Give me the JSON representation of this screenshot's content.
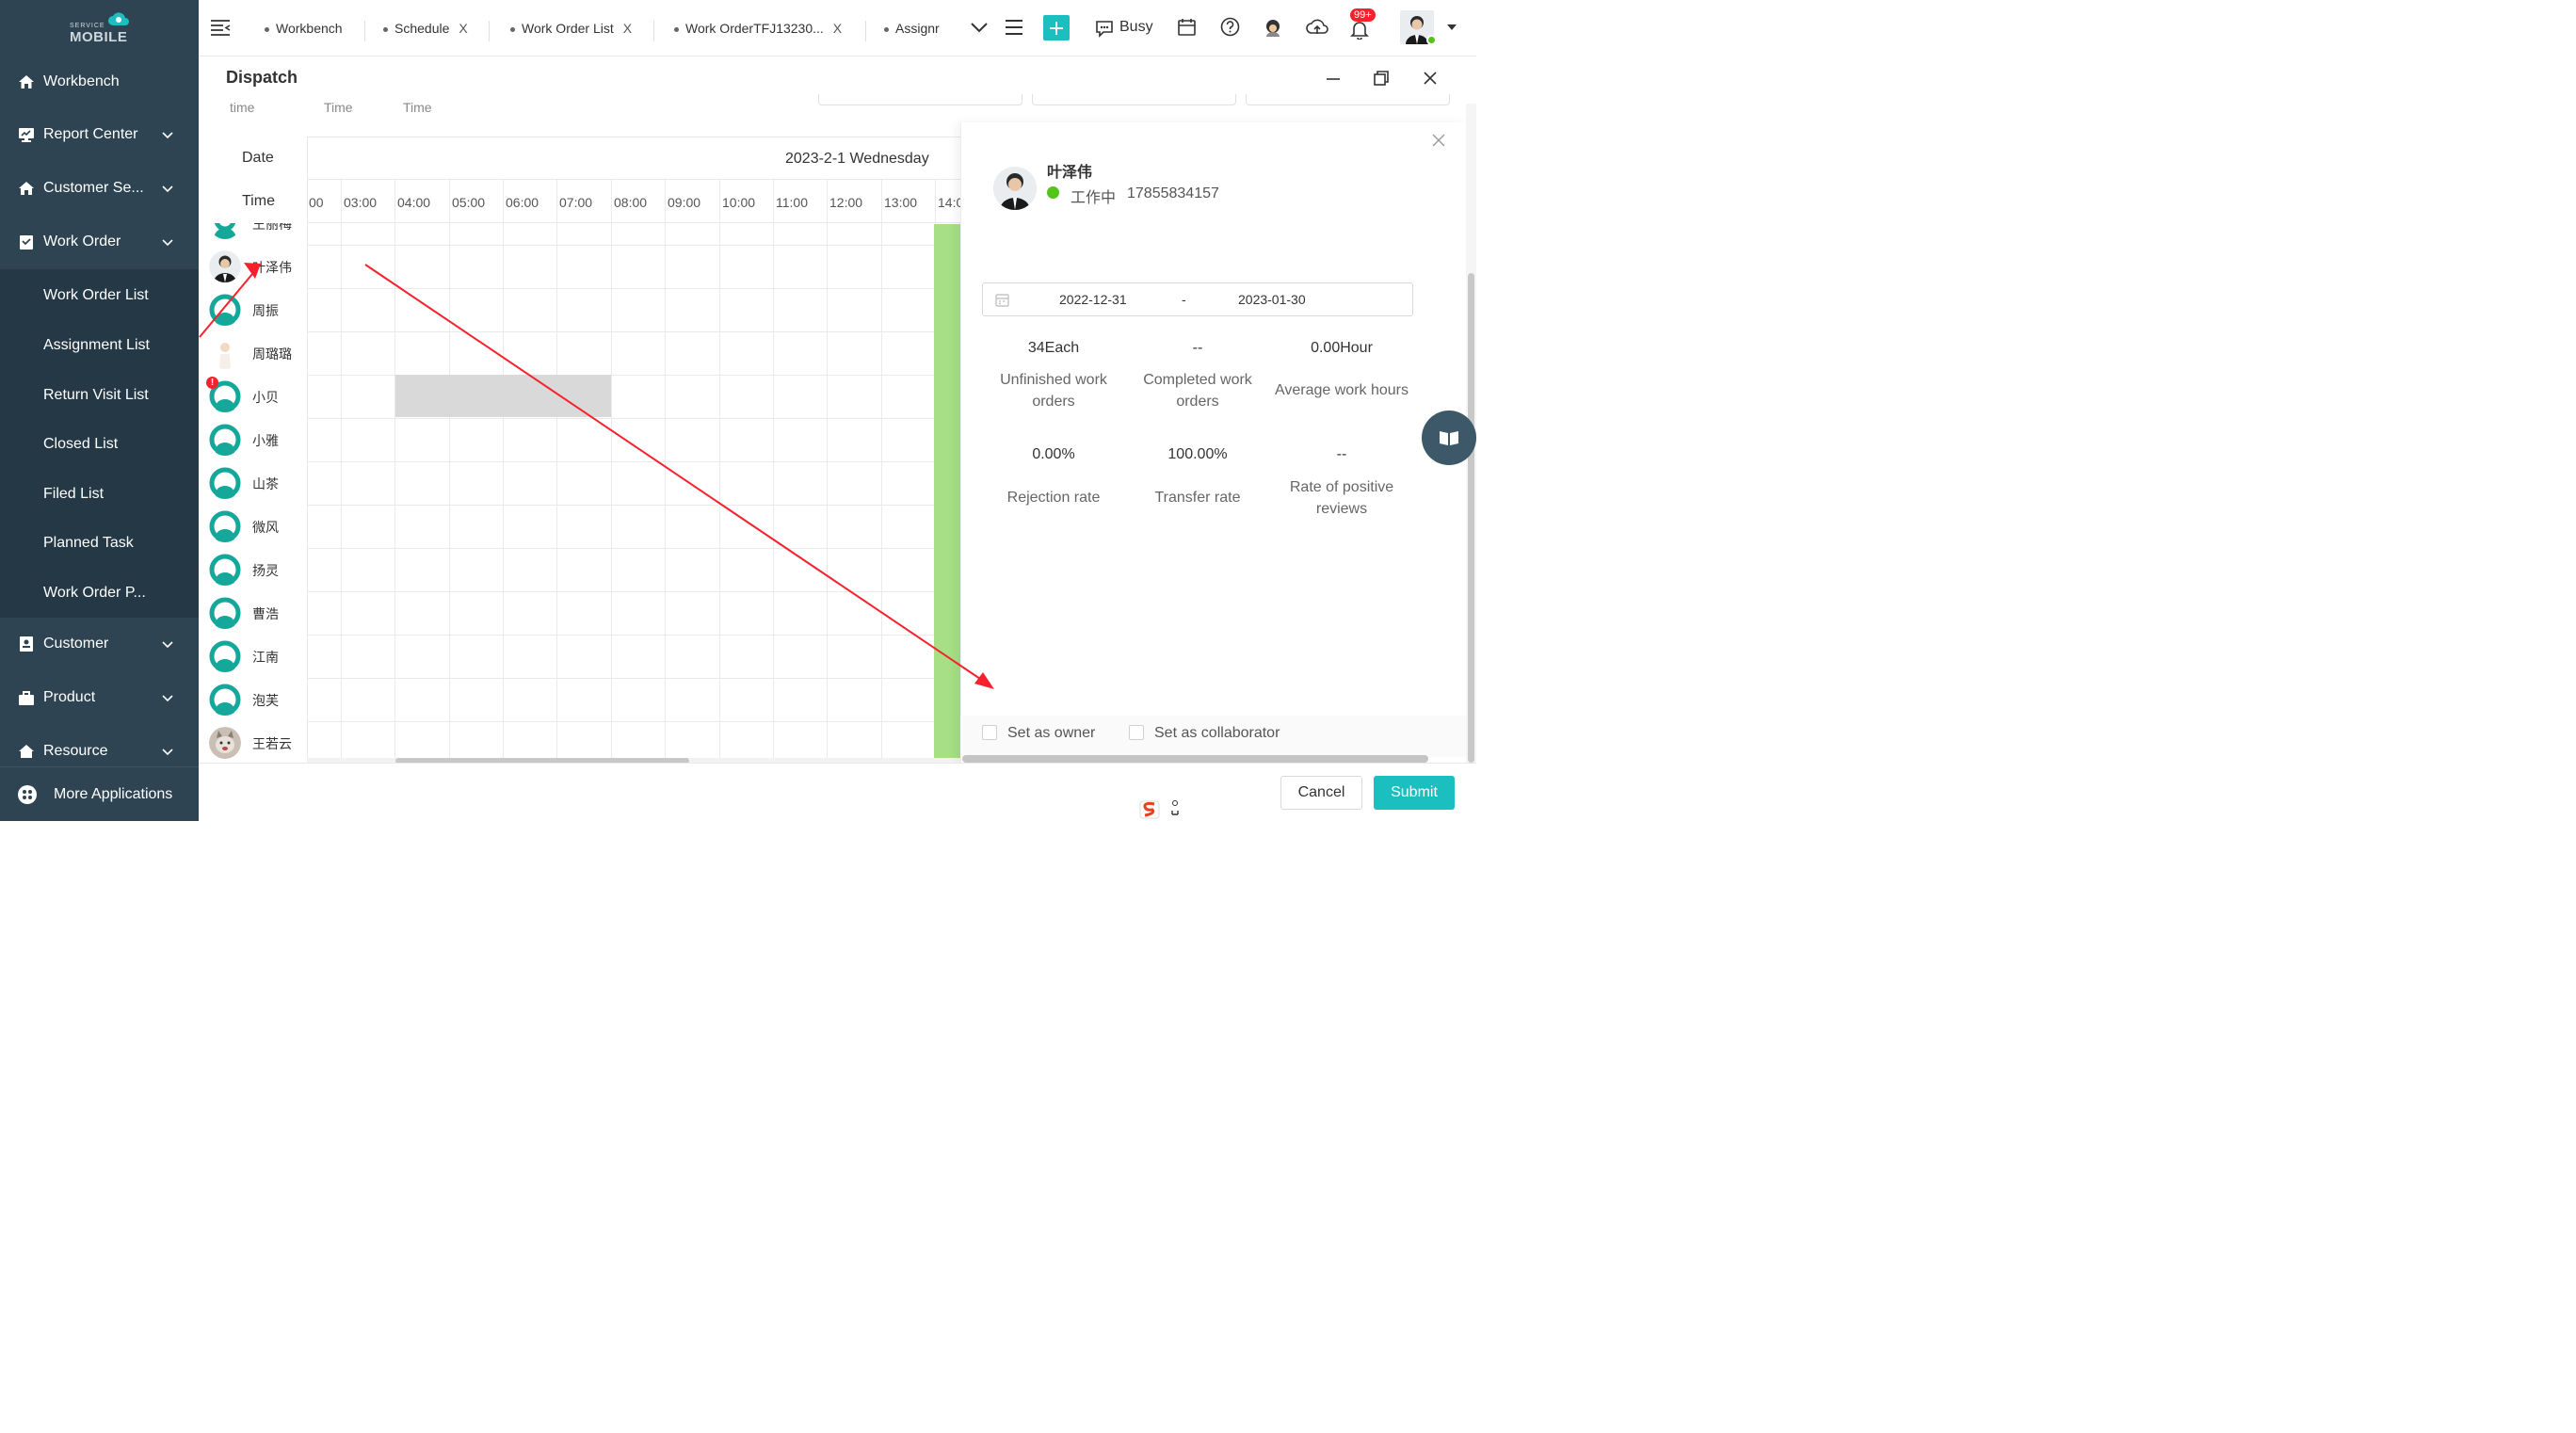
{
  "logo": {
    "top": "SERVICE",
    "bottom": "MOBILE"
  },
  "sidebar": {
    "items": [
      {
        "label": "Workbench",
        "icon": "home-icon"
      },
      {
        "label": "Report Center",
        "icon": "report-icon"
      },
      {
        "label": "Customer Se...",
        "icon": "customer-service-icon"
      },
      {
        "label": "Work Order",
        "icon": "work-order-icon"
      },
      {
        "label": "Customer",
        "icon": "customer-icon"
      },
      {
        "label": "Product",
        "icon": "product-icon"
      },
      {
        "label": "Resource",
        "icon": "resource-icon"
      }
    ],
    "subitems": [
      "Work Order List",
      "Assignment List",
      "Return Visit List",
      "Closed List",
      "Filed List",
      "Planned Task",
      "Work Order P..."
    ],
    "more": "More Applications"
  },
  "tabs": [
    {
      "label": "Workbench"
    },
    {
      "label": "Schedule",
      "close": "X"
    },
    {
      "label": "Work Order List",
      "close": "X"
    },
    {
      "label": "Work OrderTFJ13230...",
      "close": "X"
    },
    {
      "label": "Assignr"
    }
  ],
  "toolbar": {
    "status": "Busy",
    "badge": "99+"
  },
  "modal": {
    "title": "Dispatch",
    "headers": [
      "time",
      "Time",
      "Time"
    ],
    "date_label": "Date",
    "time_label": "Time",
    "date_value": "2023-2-1 Wednesday",
    "hours": [
      "00",
      "03:00",
      "04:00",
      "05:00",
      "06:00",
      "07:00",
      "08:00",
      "09:00",
      "10:00",
      "11:00",
      "12:00",
      "13:00",
      "14:0"
    ],
    "people": [
      "王丽梅",
      "叶泽伟",
      "周振",
      "周璐璐",
      "小贝",
      "小雅",
      "山茶",
      "微风",
      "扬灵",
      "曹浩",
      "江南",
      "泡芙",
      "王若云"
    ],
    "error_mark": "!"
  },
  "panel": {
    "name": "叶泽伟",
    "status": "工作中",
    "phone": "17855834157",
    "range_start": "2022-12-31",
    "range_sep": "-",
    "range_end": "2023-01-30",
    "stats": [
      {
        "value": "34Each",
        "label": "Unfinished work orders"
      },
      {
        "value": "--",
        "label": "Completed work orders"
      },
      {
        "value": "0.00Hour",
        "label": "Average work hours"
      },
      {
        "value": "0.00%",
        "label": "Rejection rate"
      },
      {
        "value": "100.00%",
        "label": "Transfer rate"
      },
      {
        "value": "--",
        "label": "Rate of positive reviews"
      }
    ],
    "set_owner": "Set as owner",
    "set_collab": "Set as collaborator"
  },
  "footer": {
    "cancel": "Cancel",
    "submit": "Submit"
  },
  "colors": {
    "sidebar": "#2e4452",
    "accent": "#1bbfbf",
    "green": "#a6df86",
    "arrow": "#f5222d"
  }
}
